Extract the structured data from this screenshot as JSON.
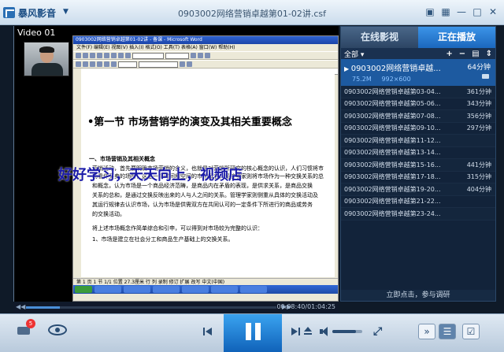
{
  "app": {
    "brand": "暴风影音",
    "title": "0903002网络营销卓越第01-02讲.csf"
  },
  "window_buttons": [
    "▣",
    "▦",
    "—",
    "□",
    "✕"
  ],
  "video": {
    "label": "Video 01",
    "word_title": "0903002网络营销卓越第01-02讲 - 备课 - Microsoft Word",
    "word_menu": "文件(F) 编辑(E) 视图(V) 插入(I) 格式(O) 工具(T) 表格(A) 窗口(W) 帮助(H)",
    "doc_heading": "•第一节  市场营销学的演变及其相关重要概念",
    "doc_sub": "一、市场营销及其相关概念",
    "doc_lines": [
      "营销活动，首先要明确市场营销的含义，也就是对营销所研究的核心概念的认识，人们习惯将市",
      "场看作买卖的场所，这是一个时间和空间的市场概念；经济学家则将市场作为一种交换关系的总",
      "和概念，认为市场是一个商品经济范畴，是商品内在矛盾的表现，是供求关系，是商品交换",
      "关系的总和，是通过交换反映出来的人与人之间的关系。管理学家则侧重从具体的交换活动及",
      "其运行规律去认识市场，认为市场是供需双方在共同认可的一定条件下所进行的商品或劳务",
      "的交换活动。",
      "     将上述市场概念作简单综合和引申，可以得到对市场较为完整的认识：",
      "1、市场是建立在社会分工和商品生产基础上的交换关系。"
    ],
    "word_status": "第 1 页   1 节   1/1   位置 27.3厘米   行   列   录制  修订  扩展  改写  中文(中国)",
    "watermark": "好好学习，天天向上，视频店"
  },
  "playback": {
    "time": "00:08:40/01:04:25",
    "progress": 0.135,
    "volume": 0.8
  },
  "panel": {
    "tabs": [
      "在线影视",
      "正在播放"
    ],
    "filter_label": "全部",
    "filter_icons": [
      "+",
      "−",
      "▤",
      "⇕"
    ],
    "current": {
      "title": "0903002网络营销卓越...",
      "duration": "64分钟",
      "size": "75.2M",
      "resolution": "992×600"
    },
    "items": [
      {
        "title": "0903002网络营销卓越第03-04...",
        "duration": "361分钟"
      },
      {
        "title": "0903002网络营销卓越第05-06...",
        "duration": "343分钟"
      },
      {
        "title": "0903002网络营销卓越第07-08...",
        "duration": "356分钟"
      },
      {
        "title": "0903002网络营销卓越第09-10...",
        "duration": "297分钟"
      },
      {
        "title": "0903002网络营销卓越第11-12...",
        "duration": ""
      },
      {
        "title": "0903002网络营销卓越第13-14...",
        "duration": ""
      },
      {
        "title": "0903002网络营销卓越第15-16...",
        "duration": "441分钟"
      },
      {
        "title": "0903002网络营销卓越第17-18...",
        "duration": "315分钟"
      },
      {
        "title": "0903002网络营销卓越第19-20...",
        "duration": "404分钟"
      },
      {
        "title": "0903002网络营销卓越第21-22...",
        "duration": ""
      },
      {
        "title": "0903002网络营销卓越第23-24...",
        "duration": ""
      }
    ],
    "join_text": "立即点击，参与调研"
  },
  "controls": {
    "badge_count": "5",
    "fullscreen_icon": "⤢",
    "right_buttons": [
      "»",
      "☰",
      "☑"
    ]
  }
}
